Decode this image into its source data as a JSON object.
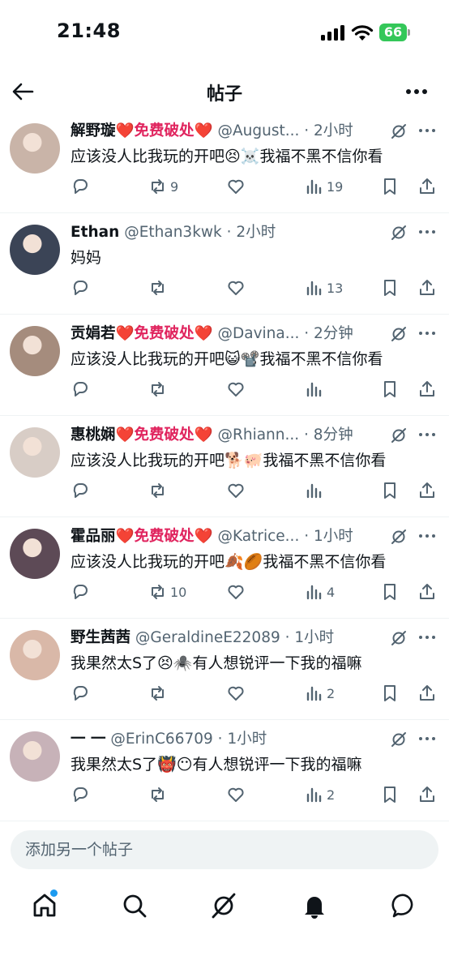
{
  "status_bar": {
    "time": "21:48",
    "battery": "66"
  },
  "header": {
    "title": "帖子"
  },
  "posts": [
    {
      "name": "解野璇",
      "badge": "❤️免费破处❤️",
      "handle": "@August...",
      "time": "2小时",
      "text": "应该没人比我玩的开吧😣☠️我福不黑不信你看",
      "retweets": "9",
      "views": "19",
      "avatar_color": "#c9b4a8"
    },
    {
      "name": "Ethan",
      "badge": "",
      "handle": "@Ethan3kwk",
      "time": "2小时",
      "text": "妈妈",
      "retweets": "",
      "views": "13",
      "avatar_color": "#3b4456"
    },
    {
      "name": "贡娟若",
      "badge": "❤️免费破处❤️",
      "handle": "@Davina...",
      "time": "2分钟",
      "text": "应该没人比我玩的开吧😺📽️我福不黑不信你看",
      "retweets": "",
      "views": "",
      "avatar_color": "#a58c7d"
    },
    {
      "name": "惠桃娴",
      "badge": "❤️免费破处❤️",
      "handle": "@Rhiann...",
      "time": "8分钟",
      "text": "应该没人比我玩的开吧🐕🐖我福不黑不信你看",
      "retweets": "",
      "views": "",
      "avatar_color": "#d8cdc6"
    },
    {
      "name": "霍品丽",
      "badge": "❤️免费破处❤️",
      "handle": "@Katrice...",
      "time": "1小时",
      "text": "应该没人比我玩的开吧🍂🏉我福不黑不信你看",
      "retweets": "10",
      "views": "4",
      "avatar_color": "#5d4a56"
    },
    {
      "name": "野生茜茜",
      "badge": "",
      "handle": "@GeraldineE22089",
      "time": "1小时",
      "text": "我果然太S了😣🕷️有人想锐评一下我的福嘛",
      "retweets": "",
      "views": "2",
      "avatar_color": "#d9b8a8"
    },
    {
      "name": "一 一",
      "badge": "",
      "handle": "@ErinC66709",
      "time": "1小时",
      "text": "我果然太S了👹😶有人想锐评一下我的福嘛",
      "retweets": "",
      "views": "2",
      "avatar_color": "#c7b2b8"
    }
  ],
  "compose": {
    "placeholder": "添加另一个帖子"
  },
  "tabbar": {
    "items": [
      "home-icon",
      "search-icon",
      "grok-icon",
      "notifications-icon",
      "messages-icon"
    ]
  }
}
